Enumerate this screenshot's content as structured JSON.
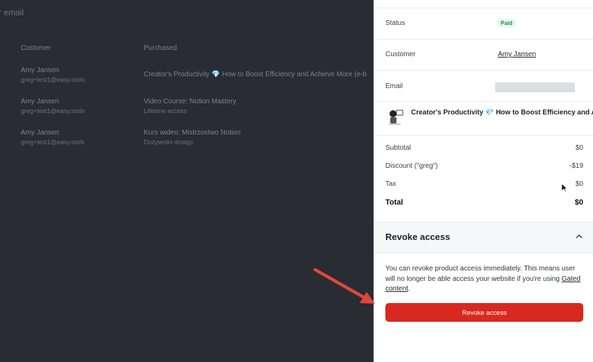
{
  "background_list": {
    "search_placeholder": "r email",
    "columns": [
      "Customer",
      "Purchased"
    ],
    "rows": [
      {
        "name": "Amy Jansen",
        "email": "greg+test1@easy.tools",
        "product": "Creator's Productivity 💎 How to Boost Efficiency and Achieve More (e-b",
        "product_sub": ""
      },
      {
        "name": "Amy Jansen",
        "email": "greg+test1@easy.tools",
        "product": "Video Course: Notion Mastery",
        "product_sub": "Lifetime access"
      },
      {
        "name": "Amy Jansen",
        "email": "greg+test1@easy.tools",
        "product": "Kurs wideo: Mistrzostwo Notion",
        "product_sub": "Dożywotni dostęp"
      }
    ]
  },
  "order": {
    "status_label": "Status",
    "status_value": "Paid",
    "customer_label": "Customer",
    "customer_value": "Amy Jansen",
    "email_label": "Email",
    "product_title": "Creator's Productivity 💎 How to Boost Efficiency and Ac",
    "subtotal_label": "Subtotal",
    "subtotal_value": "$0",
    "discount_label": "Discount (\"greg\")",
    "discount_value": "-$19",
    "tax_label": "Tax",
    "tax_value": "$0",
    "total_label": "Total",
    "total_value": "$0"
  },
  "revoke": {
    "section_title": "Revoke access",
    "description_text": "You can revoke product access immediately. This means user will no longer be able access your website if you're using ",
    "description_link": "Gated content",
    "description_end": ".",
    "button_label": "Revoke access"
  },
  "colors": {
    "accent_red": "#d9281f",
    "paid_green": "#1f8a45",
    "backdrop": "#2a2c33"
  }
}
